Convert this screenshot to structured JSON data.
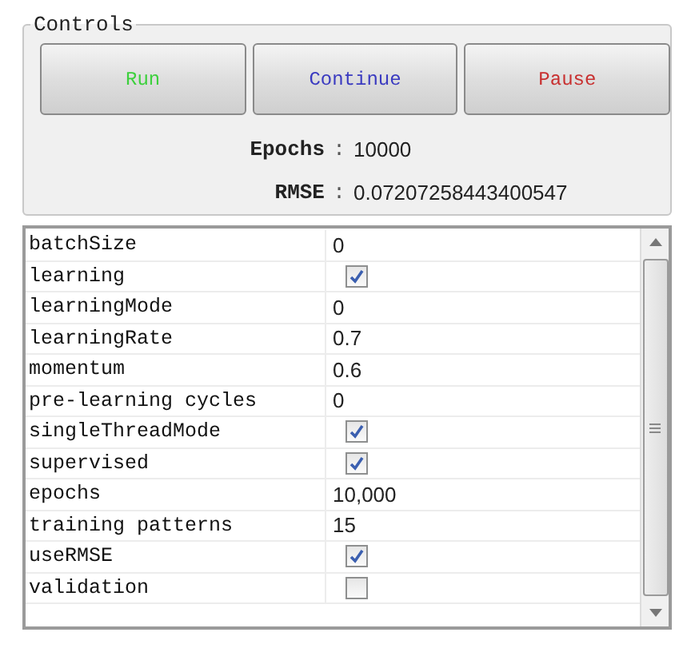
{
  "group": {
    "title": "Controls"
  },
  "buttons": [
    {
      "label": "Run",
      "color": "#3cd03c"
    },
    {
      "label": "Continue",
      "color": "#3a3ac0"
    },
    {
      "label": "Pause",
      "color": "#c83030"
    }
  ],
  "stats": [
    {
      "label": "Epochs",
      "separator": ":",
      "value": "10000"
    },
    {
      "label": "RMSE",
      "separator": ":",
      "value": "0.07207258443400547"
    }
  ],
  "properties": [
    {
      "name": "batchSize",
      "kind": "value",
      "value": "0"
    },
    {
      "name": "learning",
      "kind": "checkbox",
      "checked": true
    },
    {
      "name": "learningMode",
      "kind": "value",
      "value": "0"
    },
    {
      "name": "learningRate",
      "kind": "value",
      "value": "0.7"
    },
    {
      "name": "momentum",
      "kind": "value",
      "value": "0.6"
    },
    {
      "name": "pre-learning cycles",
      "kind": "value",
      "value": "0"
    },
    {
      "name": "singleThreadMode",
      "kind": "checkbox",
      "checked": true
    },
    {
      "name": "supervised",
      "kind": "checkbox",
      "checked": true
    },
    {
      "name": "epochs",
      "kind": "value",
      "value": "10,000"
    },
    {
      "name": "training patterns",
      "kind": "value",
      "value": "15"
    },
    {
      "name": "useRMSE",
      "kind": "checkbox",
      "checked": true
    },
    {
      "name": "validation",
      "kind": "checkbox",
      "checked": false
    }
  ]
}
